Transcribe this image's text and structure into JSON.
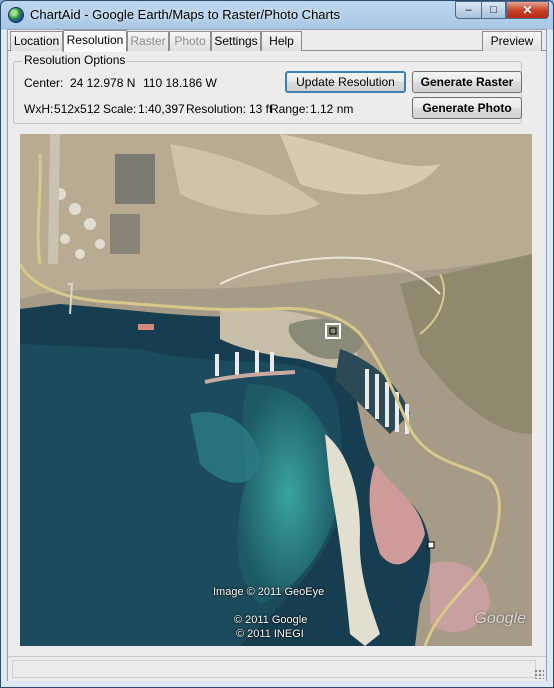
{
  "window": {
    "title": "ChartAid - Google Earth/Maps to Raster/Photo Charts"
  },
  "tabs": [
    {
      "label": "Location",
      "state": "normal"
    },
    {
      "label": "Resolution",
      "state": "active"
    },
    {
      "label": "Raster",
      "state": "disabled"
    },
    {
      "label": "Photo",
      "state": "disabled"
    },
    {
      "label": "Settings",
      "state": "normal"
    },
    {
      "label": "Help",
      "state": "normal"
    }
  ],
  "preview_label": "Preview",
  "resolution": {
    "group_label": "Resolution Options",
    "center_label": "Center:",
    "center_lat": "24 12.978 N",
    "center_lon": "110 18.186 W",
    "wxh_label": "WxH:",
    "wxh": "512x512",
    "scale_label": "Scale:",
    "scale": "1:40,397",
    "resolution_label": "Resolution:",
    "resolution": "13 ft",
    "range_label": "Range:",
    "range": "1.12 nm",
    "update_button": "Update Resolution",
    "raster_button": "Generate Raster",
    "photo_button": "Generate Photo"
  },
  "map": {
    "credit_imagery": "Image © 2011 GeoEye",
    "credit_google": "© 2011 Google",
    "credit_inegi": "© 2011 INEGI",
    "logo": "Google"
  },
  "status": {
    "text": ""
  },
  "colors": {
    "water_deep": "#143e4e",
    "water_shallow": "#2e8a8c",
    "land": "#a89a82",
    "road": "#d8c88a"
  }
}
